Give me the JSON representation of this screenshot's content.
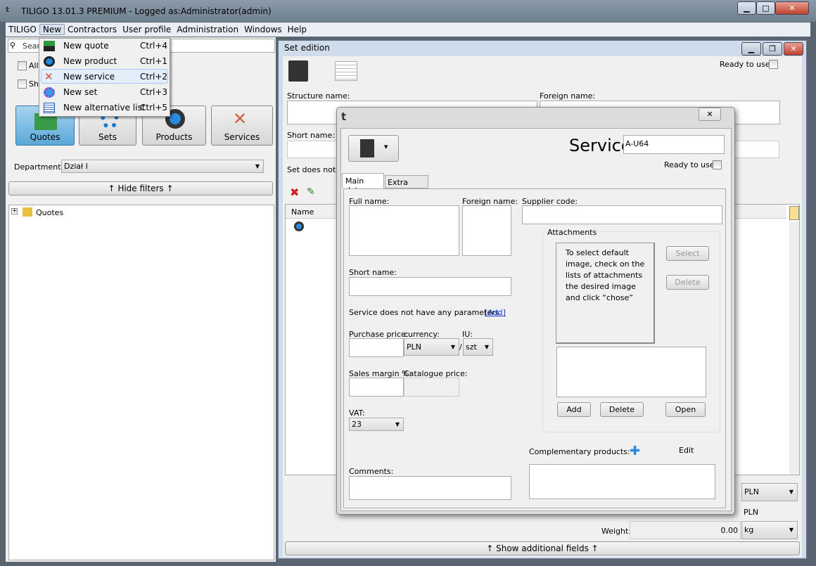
{
  "app": {
    "title": "TILIGO 13.01.3 PREMIUM - Logged as:Administrator(admin)"
  },
  "menubar": [
    "TILIGO",
    "New",
    "Contractors",
    "User profile",
    "Administration",
    "Windows",
    "Help"
  ],
  "new_menu": [
    {
      "label": "New quote",
      "shortcut": "Ctrl+4",
      "icon": "quote-icon"
    },
    {
      "label": "New product",
      "shortcut": "Ctrl+1",
      "icon": "gear-icon"
    },
    {
      "label": "New service",
      "shortcut": "Ctrl+2",
      "icon": "tools-icon"
    },
    {
      "label": "New set",
      "shortcut": "Ctrl+3",
      "icon": "set-gear-icon"
    },
    {
      "label": "New alternative list",
      "shortcut": "Ctrl+5",
      "icon": "list-icon"
    }
  ],
  "left": {
    "search_placeholder": "Search",
    "check1": "Allo",
    "check2": "Sho",
    "buttons": [
      "Quotes",
      "Sets",
      "Products",
      "Services"
    ],
    "department_label": "Department:",
    "department_value": "Dział I",
    "hide_filters": "↑ Hide filters ↑",
    "tree_root": "Quotes"
  },
  "set_edition": {
    "title": "Set edition",
    "ready": "Ready to use",
    "structure_name": "Structure name:",
    "foreign_name": "Foreign name:",
    "short_name": "Short name:",
    "no_params": "Set does not h",
    "col_name": "Name",
    "pln1": "PLN",
    "pln2": "PLN",
    "weight_label": "Weight:",
    "weight_value": "0.00",
    "weight_unit": "kg",
    "show_additional": "↑ Show additional fields ↑"
  },
  "service": {
    "heading": "Service",
    "code": "A-U64",
    "ready": "Ready to use",
    "tabs": [
      "Main data",
      "Extra fields"
    ],
    "full_name": "Full name:",
    "foreign_name": "Foreign name:",
    "supplier_code": "Supplier code:",
    "short_name": "Short name:",
    "no_params": "Service does not have any parameters.",
    "add_link": "[Add]",
    "purchase_price": "Purchase price:",
    "currency": "currency:",
    "currency_value": "PLN",
    "iu": "IU:",
    "iu_value": "szt",
    "slash": "/",
    "sales_margin": "Sales margin %:",
    "catalogue_price": "Catalogue price:",
    "vat": "VAT:",
    "vat_value": "23",
    "comments": "Comments:",
    "attachments": "Attachments",
    "attach_hint": "To select default image, check on the lists of attachments the desired image and click “chose”",
    "select": "Select",
    "delete": "Delete",
    "add": "Add",
    "delete2": "Delete",
    "open": "Open",
    "complementary": "Complementary products:",
    "edit": "Edit"
  }
}
